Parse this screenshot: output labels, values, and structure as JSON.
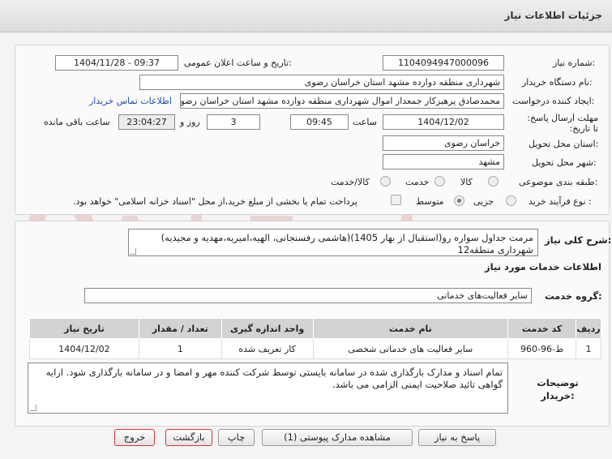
{
  "header": {
    "title": "جزئیات اطلاعات نیاز"
  },
  "form": {
    "need_number_label": "شماره نیاز:",
    "need_number": "1104094947000096",
    "announce_label": "تاریخ و ساعت اعلان عمومی:",
    "announce_value": "1404/11/28 - 09:37",
    "buyer_org_label": "نام دستگاه خریدار:",
    "buyer_org": "شهرداری منطقه دوازده مشهد استان خراسان رضوی",
    "requester_label": "ایجاد کننده درخواست:",
    "requester": "محمدصادق پرهیزکار جمعدار اموال شهرداری منطقه دوازده مشهد استان خراسان رضوی",
    "contact_link": "اطلاعات تماس خریدار",
    "deadline_label": "مهلت ارسال پاسخ: تا تاریخ:",
    "deadline_date": "1404/12/02",
    "time_label": "ساعت",
    "deadline_time": "09:45",
    "days_value": "3",
    "days_label": "روز و",
    "remaining_value": "23:04:27",
    "remaining_label": "ساعت باقی مانده",
    "province_label": "استان محل تحویل:",
    "province": "خراسان رضوی",
    "city_label": "شهر محل تحویل:",
    "city": "مشهد",
    "category_label": "طبقه بندی موضوعی:",
    "category_options": [
      "کالا",
      "خدمت",
      "کالا/خدمت"
    ],
    "process_label": "نوع فرآیند خرید :",
    "process_options": [
      "جزیی",
      "متوسط"
    ],
    "payment_note": "پرداخت تمام یا بخشی از مبلغ خرید،از محل \"اسناد خزانه اسلامی\" خواهد بود."
  },
  "details": {
    "general_desc_label": "شرح کلی نیاز:",
    "general_desc": "مرمت جداول سواره رو(استقبال از بهار 1405)(هاشمی رفسنجانی، الهیه،امیریه،مهدیه و مجیدیه)  شهرداری منطقه12",
    "services_info_title": "اطلاعات خدمات مورد نیاز",
    "service_group_label": "گروه خدمت:",
    "service_group": "سایر فعالیت‌های خدماتی",
    "table": {
      "headers": [
        "ردیف",
        "کد خدمت",
        "نام خدمت",
        "واحد اندازه گیری",
        "تعداد / مقدار",
        "تاریخ نیاز"
      ],
      "rows": [
        [
          "1",
          "ط-96-960",
          "سایر فعالیت های خدماتی شخصی",
          "کار تعریف شده",
          "1",
          "1404/12/02"
        ]
      ]
    },
    "buyer_notes_label": "توضیحات خریدار:",
    "buyer_notes": "تمام اسناد و مدارک بارگذاری شده در سامانه بایستی توسط شرکت کننده مهر و امضا و در سامانه بارگذاری شود. ارایه گواهی تائید صلاحیت ایمنی الزامی می باشد."
  },
  "buttons": {
    "reply": "پاسخ به نیاز",
    "attachments": "مشاهده مدارک پیوستی (1)",
    "print": "چاپ",
    "back": "بازگشت",
    "exit": "خروج"
  },
  "colors": {
    "link": "#1e4fb7",
    "header_bg": "#d3d3d3",
    "danger_border": "#dd3333"
  }
}
